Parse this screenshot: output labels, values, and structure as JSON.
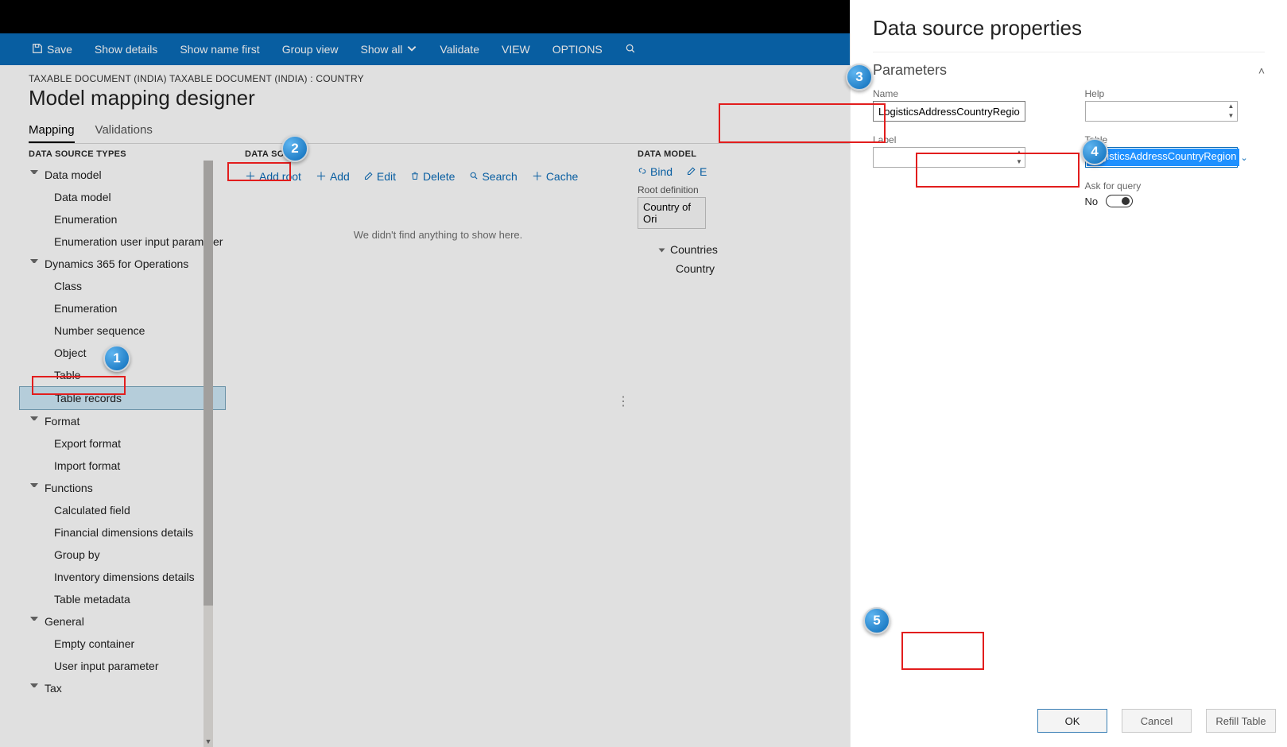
{
  "commandbar": {
    "save": "Save",
    "show_details": "Show details",
    "show_name_first": "Show name first",
    "group_view": "Group view",
    "show_all": "Show all",
    "validate": "Validate",
    "view": "VIEW",
    "options": "OPTIONS"
  },
  "page": {
    "breadcrumb": "TAXABLE DOCUMENT (INDIA) TAXABLE DOCUMENT (INDIA) : COUNTRY",
    "title": "Model mapping designer",
    "tabs": {
      "mapping": "Mapping",
      "validations": "Validations"
    }
  },
  "types": {
    "title": "DATA SOURCE TYPES",
    "groups": [
      {
        "label": "Data model",
        "items": [
          "Data model",
          "Enumeration",
          "Enumeration user input parameter"
        ]
      },
      {
        "label": "Dynamics 365 for Operations",
        "items": [
          "Class",
          "Enumeration",
          "Number sequence",
          "Object",
          "Table",
          "Table records"
        ]
      },
      {
        "label": "Format",
        "items": [
          "Export format",
          "Import format"
        ]
      },
      {
        "label": "Functions",
        "items": [
          "Calculated field",
          "Financial dimensions details",
          "Group by",
          "Inventory dimensions details",
          "Table metadata"
        ]
      },
      {
        "label": "General",
        "items": [
          "Empty container",
          "User input parameter"
        ]
      },
      {
        "label": "Tax",
        "items": []
      }
    ],
    "selected": "Table records"
  },
  "sources": {
    "title_prefix": "DATA SOURC",
    "toolbar": {
      "add_root": "Add root",
      "add": "Add",
      "edit": "Edit",
      "delete": "Delete",
      "search": "Search",
      "cache": "Cache"
    },
    "empty": "We didn't find anything to show here."
  },
  "model": {
    "title": "DATA MODEL",
    "bind": "Bind",
    "edit_prefix": "E",
    "root_label": "Root definition",
    "root_value": "Country of Ori",
    "rows": [
      "Countries",
      "Country"
    ]
  },
  "panel": {
    "title": "Data source properties",
    "section": "Parameters",
    "name_label": "Name",
    "name_value": "LogisticsAddressCountryRegion",
    "help_label": "Help",
    "help_value": "",
    "label_label": "Label",
    "label_value": "",
    "table_label": "Table",
    "table_value": "LogisticsAddressCountryRegion",
    "ask_label": "Ask for query",
    "ask_value": "No",
    "ok": "OK",
    "cancel": "Cancel",
    "refill": "Refill Table"
  },
  "callouts": {
    "c1": "1",
    "c2": "2",
    "c3": "3",
    "c4": "4",
    "c5": "5"
  }
}
